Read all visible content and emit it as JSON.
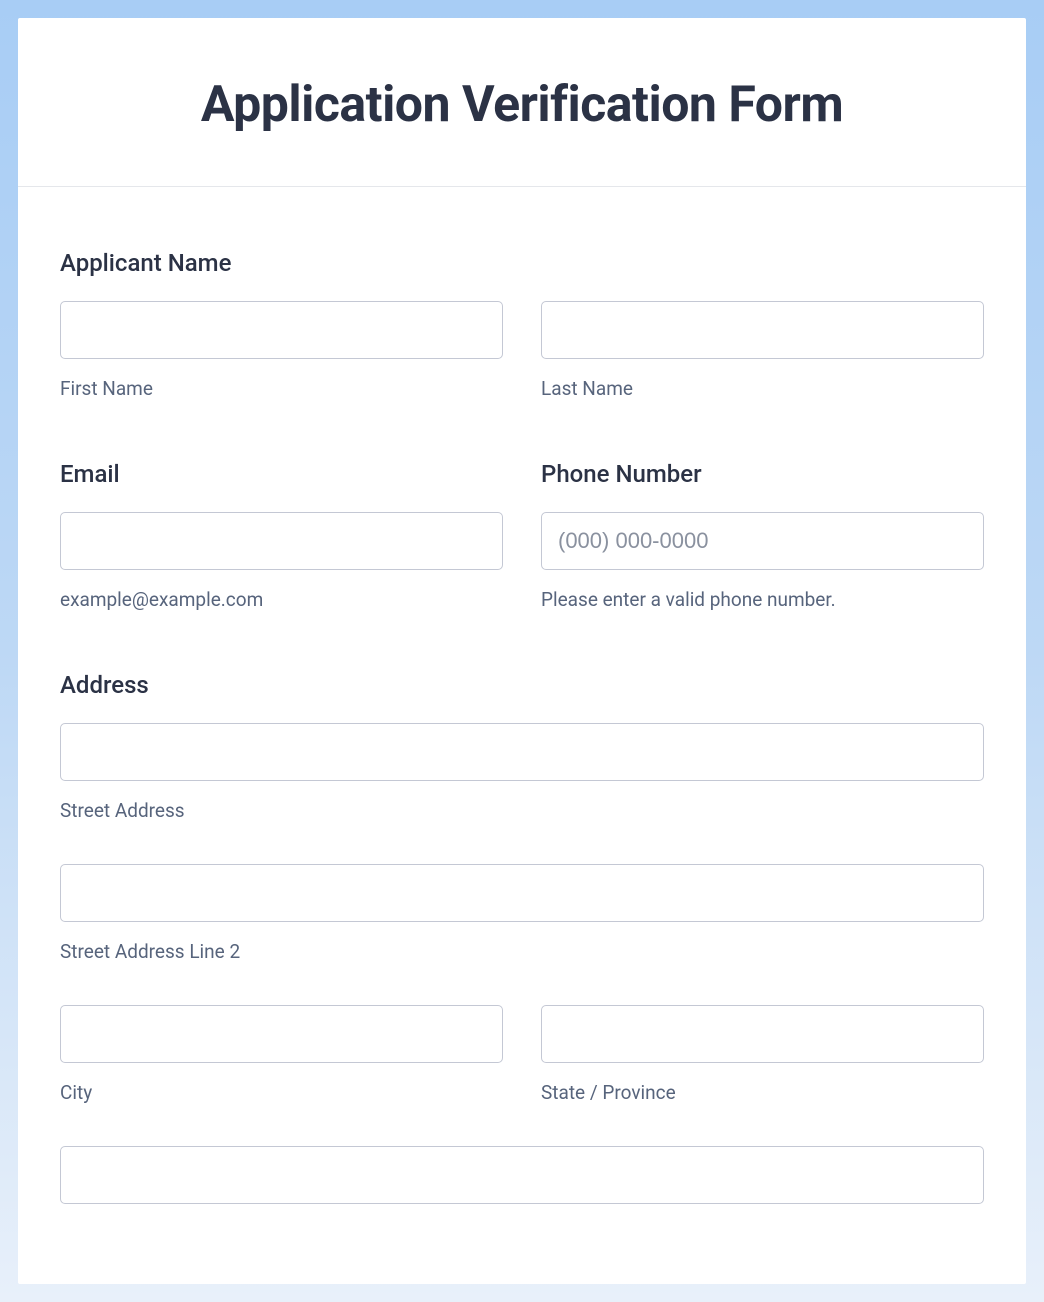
{
  "header": {
    "title": "Application Verification Form"
  },
  "applicant_name": {
    "label": "Applicant Name",
    "first_name": {
      "value": "",
      "sublabel": "First Name"
    },
    "last_name": {
      "value": "",
      "sublabel": "Last Name"
    }
  },
  "email": {
    "label": "Email",
    "value": "",
    "sublabel": "example@example.com"
  },
  "phone": {
    "label": "Phone Number",
    "value": "",
    "placeholder": "(000) 000-0000",
    "sublabel": "Please enter a valid phone number."
  },
  "address": {
    "label": "Address",
    "street": {
      "value": "",
      "sublabel": "Street Address"
    },
    "street2": {
      "value": "",
      "sublabel": "Street Address Line 2"
    },
    "city": {
      "value": "",
      "sublabel": "City"
    },
    "state": {
      "value": "",
      "sublabel": "State / Province"
    },
    "postal": {
      "value": ""
    }
  }
}
